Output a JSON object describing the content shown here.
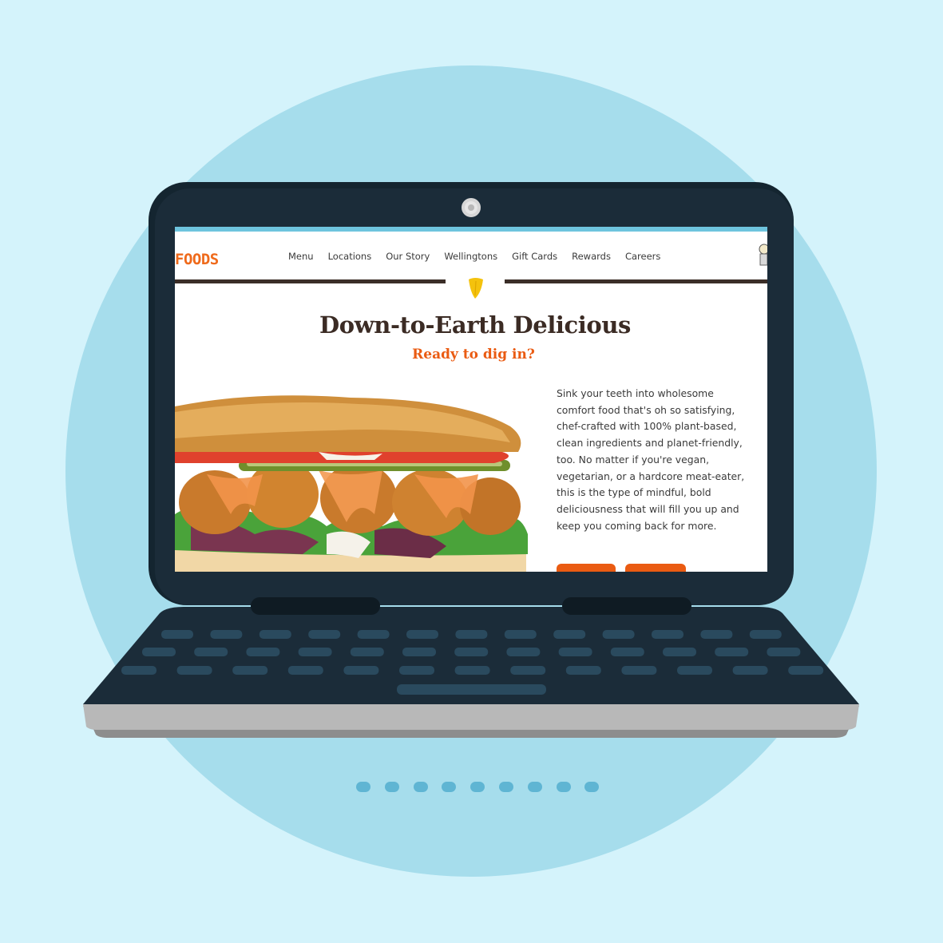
{
  "colors": {
    "background": "#d4f3fb",
    "circle": "#a6ddec",
    "laptop_body": "#1b2c39",
    "accent_orange": "#ea5b12",
    "heading_brown": "#3b2b24"
  },
  "site": {
    "logo_text": "FOODS",
    "nav": [
      "Menu",
      "Locations",
      "Our Story",
      "Wellingtons",
      "Gift Cards",
      "Rewards",
      "Careers"
    ],
    "headline": "Down-to-Earth Delicious",
    "subheadline": "Ready to dig in?",
    "body": "Sink your teeth into wholesome comfort food that's oh so satisfying, chef-crafted with 100% plant-based, clean ingredients and planet-friendly, too. No matter if you're vegan, vegetarian, or a hardcore meat-eater, this is the type of mindful, bold deliciousness that will fill you up and keep you coming back for more."
  },
  "icons": {
    "camera": "webcam-icon",
    "leaf": "leaf-icon",
    "mascot": "mascot-figure-icon"
  },
  "pager": {
    "dot_count": 9
  }
}
